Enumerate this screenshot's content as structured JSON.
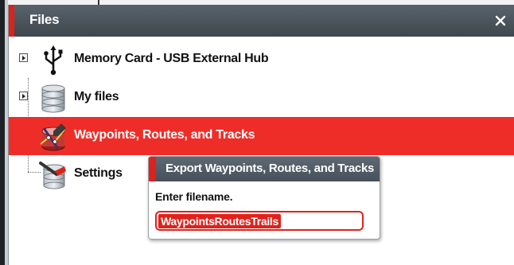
{
  "window": {
    "title": "Files"
  },
  "tree": {
    "items": [
      {
        "label": "Memory Card - USB External Hub",
        "icon": "usb-icon",
        "expandable": true
      },
      {
        "label": "My files",
        "icon": "database-icon",
        "expandable": true
      },
      {
        "label": "Waypoints, Routes, and Tracks",
        "icon": "waypoints-icon",
        "selected": true
      },
      {
        "label": "Settings",
        "icon": "database-settings-icon"
      }
    ]
  },
  "dialog": {
    "title": "Export Waypoints, Routes, and Tracks",
    "prompt": "Enter filename.",
    "filename_value": "WaypointsRoutesTrails"
  },
  "colors": {
    "accent": "#d9231c",
    "selection": "#ef2d28",
    "titlebar": "#4a535b"
  }
}
